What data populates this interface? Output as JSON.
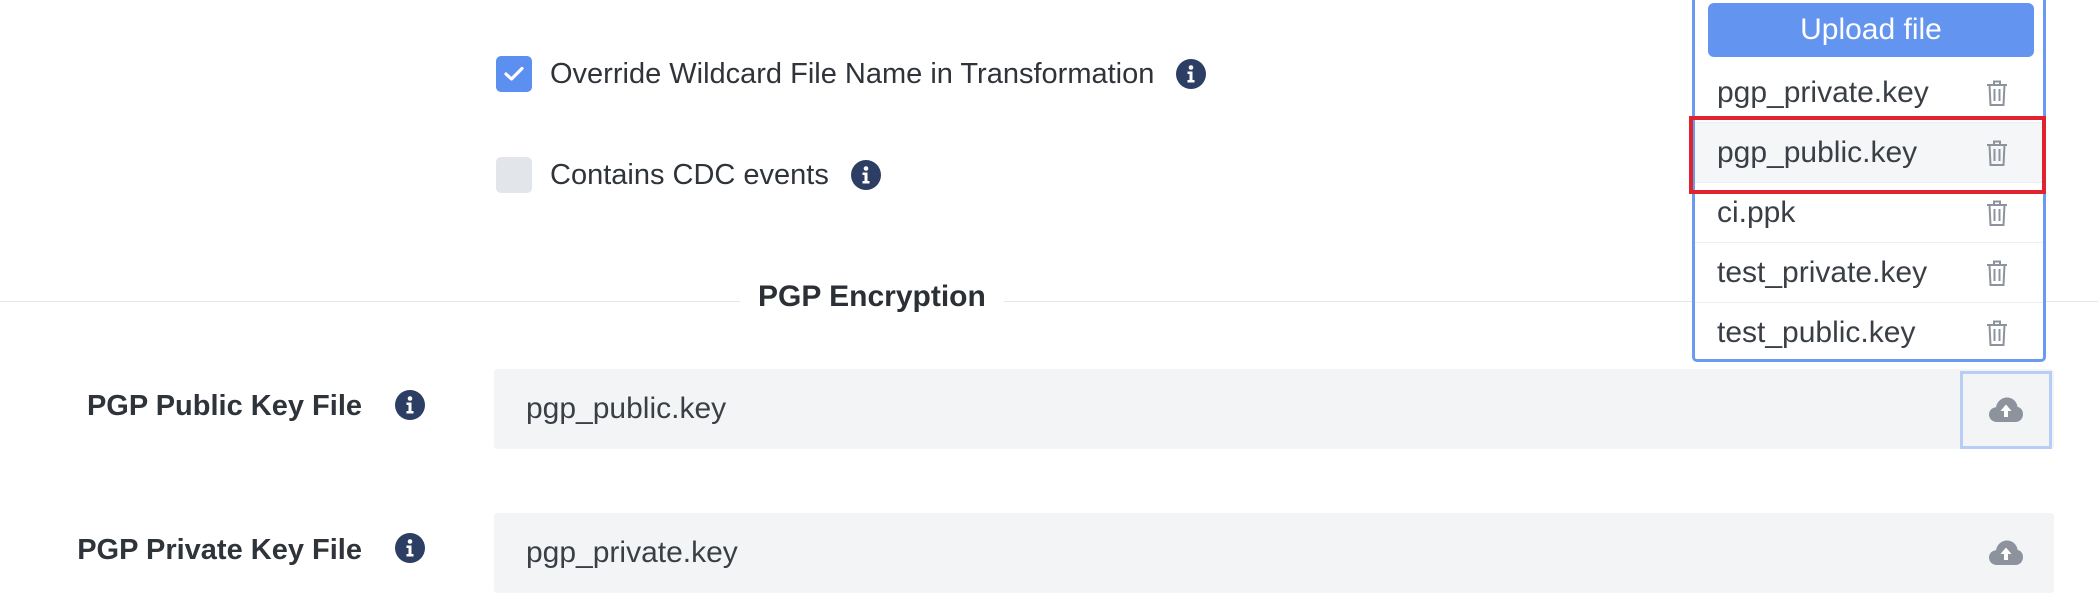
{
  "options": {
    "override_wildcard": {
      "label": "Override Wildcard File Name in Transformation",
      "checked": true
    },
    "contains_cdc": {
      "label": "Contains CDC events",
      "checked": false
    }
  },
  "section": {
    "title": "PGP Encryption"
  },
  "fields": {
    "public_key": {
      "label": "PGP Public Key File",
      "value": "pgp_public.key"
    },
    "private_key": {
      "label": "PGP Private Key File",
      "value": "pgp_private.key"
    }
  },
  "file_dropdown": {
    "upload_label": "Upload file",
    "items": [
      {
        "name": "pgp_private.key"
      },
      {
        "name": "pgp_public.key"
      },
      {
        "name": "ci.ppk"
      },
      {
        "name": "test_private.key"
      },
      {
        "name": "test_public.key"
      }
    ],
    "highlighted": "pgp_public.key"
  },
  "icons": {
    "info": "info-icon",
    "check": "check-icon",
    "trash": "trash-icon",
    "upload": "cloud-upload-icon"
  },
  "colors": {
    "accent": "#6394f0",
    "info_icon": "#2c3e63",
    "highlight_border": "#e1232f",
    "input_bg": "#f3f4f6"
  }
}
